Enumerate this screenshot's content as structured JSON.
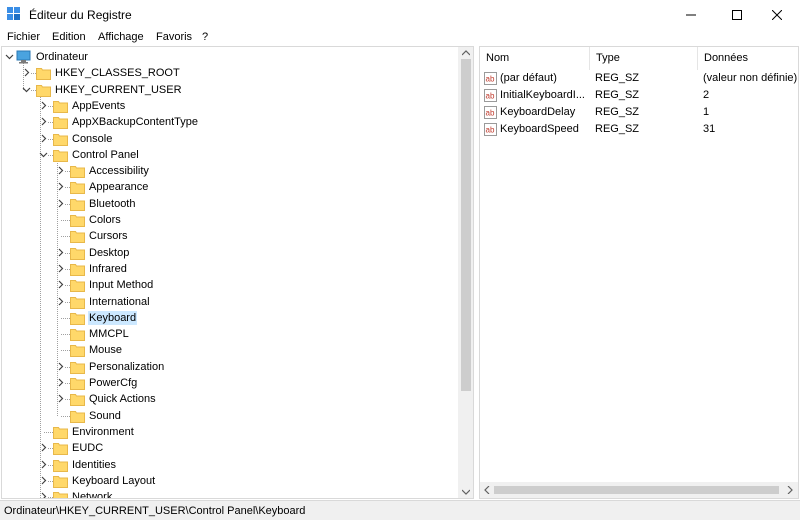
{
  "window": {
    "title": "Éditeur du Registre",
    "icon": "registry-icon"
  },
  "menu": {
    "items": [
      "Fichier",
      "Edition",
      "Affichage",
      "Favoris",
      "?"
    ]
  },
  "tree": {
    "root": "Ordinateur",
    "hkcr": "HKEY_CLASSES_ROOT",
    "hkcu": "HKEY_CURRENT_USER",
    "level2": [
      "AppEvents",
      "AppXBackupContentType",
      "Console",
      "Control Panel"
    ],
    "control_panel_children": [
      "Accessibility",
      "Appearance",
      "Bluetooth",
      "Colors",
      "Cursors",
      "Desktop",
      "Infrared",
      "Input Method",
      "International",
      "Keyboard",
      "MMCPL",
      "Mouse",
      "Personalization",
      "PowerCfg",
      "Quick Actions",
      "Sound"
    ],
    "level2_after": [
      "Environment",
      "EUDC",
      "Identities",
      "Keyboard Layout",
      "Network"
    ],
    "selected": "Keyboard"
  },
  "list": {
    "headers": {
      "name": "Nom",
      "type": "Type",
      "data": "Données"
    },
    "rows": [
      {
        "name": "(par défaut)",
        "type": "REG_SZ",
        "data": "(valeur non définie)"
      },
      {
        "name": "InitialKeyboardI...",
        "type": "REG_SZ",
        "data": "2"
      },
      {
        "name": "KeyboardDelay",
        "type": "REG_SZ",
        "data": "1"
      },
      {
        "name": "KeyboardSpeed",
        "type": "REG_SZ",
        "data": "31"
      }
    ]
  },
  "status": {
    "path": "Ordinateur\\HKEY_CURRENT_USER\\Control Panel\\Keyboard"
  },
  "colors": {
    "selection": "#cce8ff",
    "folder": "#ffd86a",
    "folder_dark": "#e8b84a"
  }
}
